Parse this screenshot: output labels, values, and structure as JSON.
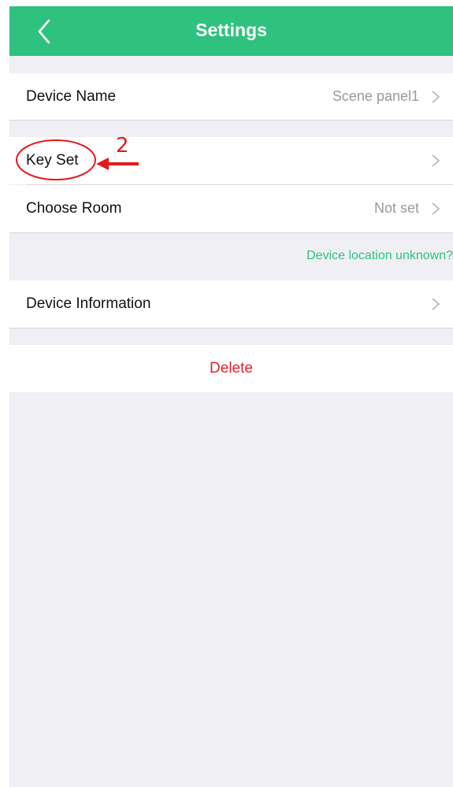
{
  "navbar": {
    "title": "Settings",
    "back_icon": "chevron-left-icon",
    "color": "#2ec27e"
  },
  "rows": {
    "device_name": {
      "label": "Device Name",
      "value": "Scene panel1"
    },
    "key_set": {
      "label": "Key Set"
    },
    "choose_room": {
      "label": "Choose Room",
      "value": "Not set"
    },
    "device_information": {
      "label": "Device Information"
    }
  },
  "location_hint": "Device location unknown?",
  "delete": {
    "label": "Delete",
    "color": "#e0242b"
  },
  "annotation": {
    "step_number": "2",
    "color": "#e31b1b"
  }
}
